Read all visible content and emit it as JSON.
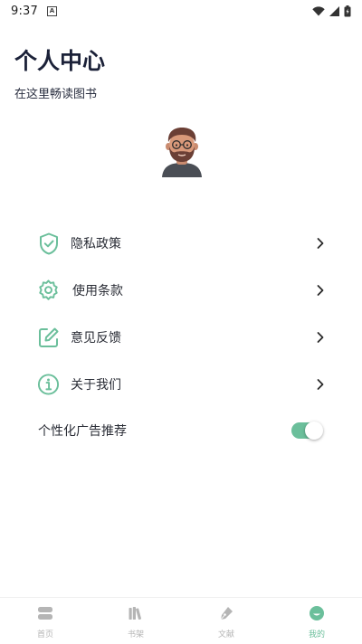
{
  "status_bar": {
    "time": "9:37"
  },
  "header": {
    "title": "个人中心",
    "subtitle": "在这里畅读图书"
  },
  "menu": {
    "items": [
      {
        "label": "隐私政策",
        "icon": "shield-check-icon"
      },
      {
        "label": "使用条款",
        "icon": "gear-icon"
      },
      {
        "label": "意见反馈",
        "icon": "edit-icon"
      },
      {
        "label": "关于我们",
        "icon": "info-icon"
      }
    ],
    "toggle": {
      "label": "个性化广告推荐",
      "checked": true
    }
  },
  "bottom_nav": {
    "items": [
      {
        "label": "首页",
        "icon": "home-icon",
        "active": false
      },
      {
        "label": "书架",
        "icon": "bookshelf-icon",
        "active": false
      },
      {
        "label": "文献",
        "icon": "pen-icon",
        "active": false
      },
      {
        "label": "我的",
        "icon": "profile-icon",
        "active": true
      }
    ]
  },
  "colors": {
    "accent": "#6bbf9b",
    "title": "#1b2138",
    "nav_inactive": "#b5b5b5"
  }
}
